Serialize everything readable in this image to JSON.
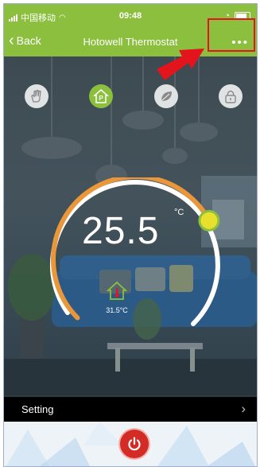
{
  "status_bar": {
    "carrier": "中国移动",
    "time": "09:48"
  },
  "nav": {
    "back_label": "Back",
    "title": "Hotowell Thermostat",
    "more_icon": "ellipsis-icon"
  },
  "modes": [
    {
      "name": "manual-hand-icon",
      "active": false
    },
    {
      "name": "program-p-icon",
      "active": true
    },
    {
      "name": "eco-leaf-icon",
      "active": false
    },
    {
      "name": "lock-icon",
      "active": false
    }
  ],
  "thermostat": {
    "set_temperature": "25.5",
    "unit": "°C",
    "room_temperature": "31.5°C",
    "dial_level": 0.73
  },
  "setting": {
    "label": "Setting"
  },
  "colors": {
    "accent_green": "#8cbf3e",
    "dial_orange": "#e9973a",
    "knob_yellow": "#e7e02d",
    "power_red": "#d32b25",
    "annotation_red": "#e3141c"
  }
}
